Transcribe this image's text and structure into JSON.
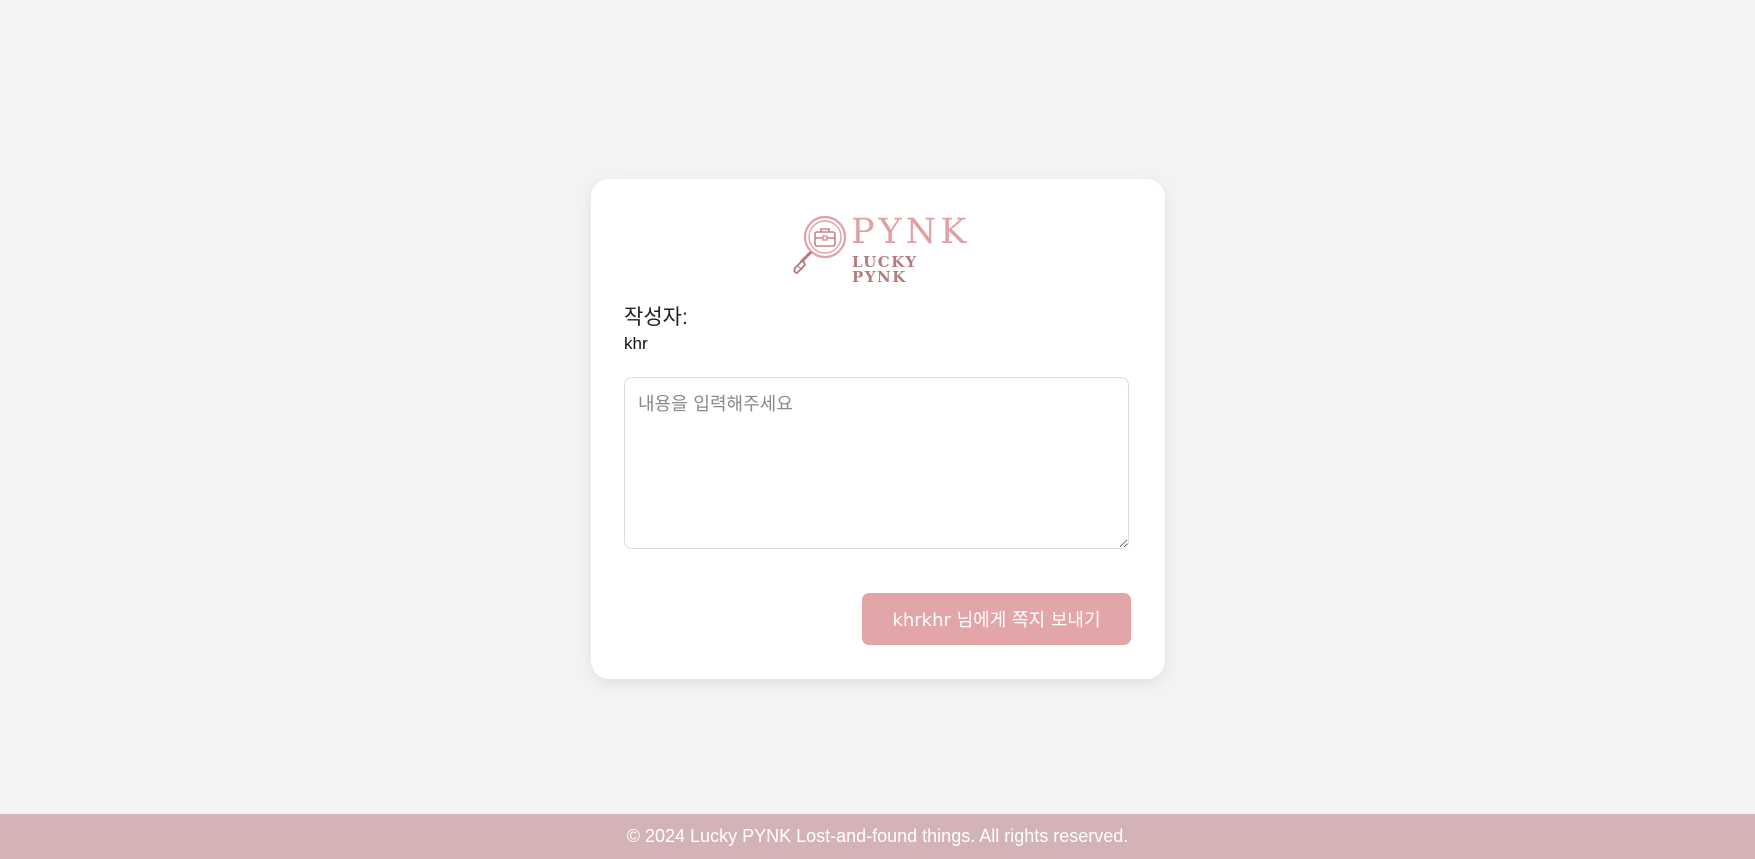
{
  "logo": {
    "title": "PYNK",
    "subtitle": "LUCKY PYNK",
    "icon": "magnifier-briefcase-icon"
  },
  "form": {
    "author_label": "작성자:",
    "author_name": "khr",
    "message_placeholder": "내용을 입력해주세요",
    "message_value": "",
    "send_label": "khrkhr 님에게 쪽지 보내기"
  },
  "footer": {
    "text": "© 2024 Lucky PYNK Lost-and-found things. All rights reserved."
  },
  "colors": {
    "background": "#f3f3f3",
    "card": "#ffffff",
    "accent": "#e3a6a8",
    "logo": "#e0a0a4",
    "footer": "#d4b3b6"
  }
}
